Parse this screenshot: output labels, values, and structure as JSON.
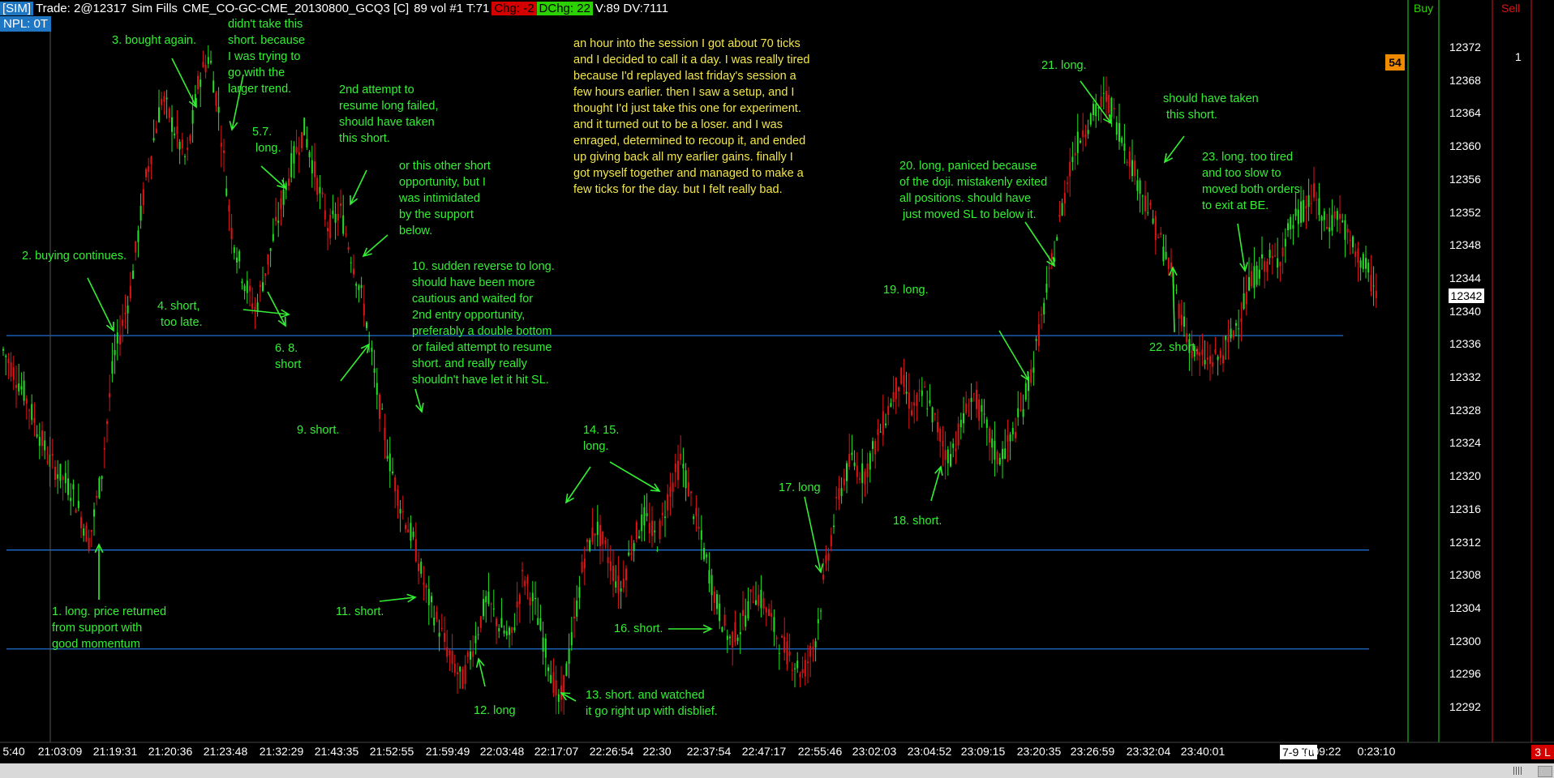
{
  "header": {
    "mode": "[SIM]",
    "trade": "Trade: 2@12317",
    "fills": "Sim Fills",
    "instrument": "CME_CO-GC-CME_20130800_GCQ3 [C]",
    "stats": "89 vol  #1 T:71",
    "chg": "Chg: -2",
    "dchg": "DChg: 22",
    "vol": "V:89 DV:7111",
    "npl": "NPL: 0T"
  },
  "panels": {
    "buy": "Buy",
    "sell": "Sell",
    "count": "1"
  },
  "badges": {
    "value": "54",
    "current_price": "12342",
    "date": "7-9 Tu",
    "corner": "3 L"
  },
  "colors": {
    "up": "#21e021",
    "down": "#e01414",
    "support_line": "#1f6fd1",
    "annotation": "#34ee34",
    "commentary": "#f2e64a"
  },
  "price_axis": [
    "12372",
    "12368",
    "12364",
    "12360",
    "12356",
    "12352",
    "12348",
    "12344",
    "12340",
    "12336",
    "12332",
    "12328",
    "12324",
    "12320",
    "12316",
    "12312",
    "12308",
    "12304",
    "12300",
    "12296",
    "12292"
  ],
  "time_axis": [
    "5:40",
    "21:03:09",
    "21:19:31",
    "21:20:36",
    "21:23:48",
    "21:32:29",
    "21:43:35",
    "21:52:55",
    "21:59:49",
    "22:03:48",
    "22:17:07",
    "22:26:54",
    "22:30",
    "22:37:54",
    "22:47:17",
    "22:55:46",
    "23:02:03",
    "23:04:52",
    "23:09:15",
    "23:20:35",
    "23:26:59",
    "23:32:04",
    "23:40:01",
    "0:09:22",
    "0:23:10"
  ],
  "commentary": "an hour into the session I got about 70 ticks\nand I decided to call it a day. I was really tired\nbecause I'd replayed last friday's session a\nfew hours earlier. then I saw a setup, and I\nthought I'd just take this one for experiment.\nand it turned out to be a loser. and I was\nenraged, determined to recoup it, and ended\nup giving back all my earlier gains. finally I\ngot myself together and managed to make a\nfew ticks for the day. but I felt really bad.",
  "annotations": [
    "didn't take this\nshort. because\nI was trying to\ngo with the\nlarger trend.",
    "3. bought again.",
    "2nd attempt to\nresume long failed,\nshould have taken\nthis short.",
    "5.7.\n long.",
    "or this other short\nopportunity, but I\nwas intimidated\nby the support\nbelow.",
    "2. buying continues.",
    "4. short,\n too late.",
    "6. 8.\nshort",
    "10. sudden reverse to long.\nshould have been more\ncautious and waited for\n2nd entry opportunity,\npreferably a double bottom\nor failed attempt to resume\nshort. and really really\nshouldn't have let it hit SL.",
    "9. short.",
    "11. short.",
    "12. long",
    "13. short. and watched\nit go right up with disblief.",
    "14. 15.\nlong.",
    "16. short.",
    "17. long",
    "18. short.",
    "19. long.",
    "20. long, paniced because\nof the doji. mistakenly exited\nall positions. should have\n just moved SL to below it.",
    "21. long.",
    "should have taken\n this short.",
    "23. long. too tired\nand too slow to\nmoved both orders\nto exit at BE.",
    "22. short.",
    "1. long. price returned\nfrom support with\ngood momentum"
  ]
}
